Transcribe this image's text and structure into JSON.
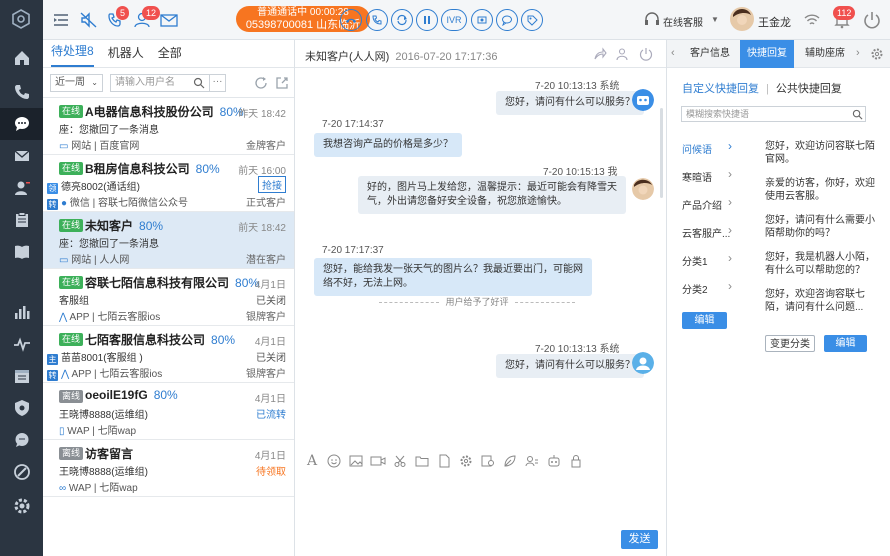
{
  "colors": {
    "accent": "#2f7dd0",
    "online": "#3db05a",
    "offline": "#8a8f94",
    "orange": "#f77520",
    "nav_bg": "#2b3541"
  },
  "topbar": {
    "badges": {
      "missed": "5",
      "queue": "12",
      "notify": "112"
    },
    "call": {
      "line1": "普通通话中 00:00:28",
      "line2": "05398700081 山东临沂"
    },
    "ivr": "IVR",
    "agent_status": "在线客服",
    "agent_name": "王金龙"
  },
  "list": {
    "tabs": [
      "待处理8",
      "机器人",
      "全部"
    ],
    "filter_value": "近一周",
    "search_placeholder": "请输入用户名",
    "more": "···",
    "items": [
      {
        "status": "在线",
        "name": "A电器信息科技股份公司",
        "pct": "80%",
        "time": "昨天 18:42",
        "line2": "座：您撤回了一条消息",
        "line3": "网站 | 百度官网",
        "right2": "",
        "right3": "金牌客户"
      },
      {
        "status": "在线",
        "name": "B租房信息科技公司",
        "pct": "80%",
        "time": "前天 16:00",
        "line2": "德亮8002(通话组)",
        "line3": "微信 | 容联七陌微信公众号",
        "right2": "抢接",
        "right3": "正式客户"
      },
      {
        "status": "在线",
        "name": "未知客户",
        "pct": "80%",
        "time": "前天 18:42",
        "line2": "座：您撤回了一条消息",
        "line3": "网站 | 人人网",
        "right2": "",
        "right3": "潜在客户"
      },
      {
        "status": "在线",
        "name": "容联七陌信息科技有限公司",
        "pct": "80%",
        "time": "4月1日",
        "line2": "客服组",
        "line3": "APP | 七陌云客服ios",
        "right2": "已关闭",
        "right3": "银牌客户"
      },
      {
        "status": "在线",
        "name": "七陌客服信息科技公司",
        "pct": "80%",
        "time": "4月1日",
        "line2": "苗苗8001(客服组 )",
        "line3": "APP | 七陌云客服ios",
        "right2": "已关闭",
        "right3": "银牌客户"
      },
      {
        "status": "离线",
        "name": "oeoilE19fG",
        "pct": "80%",
        "time": "4月1日",
        "line2": "王晓博8888(运维组)",
        "line3": "WAP | 七陌wap",
        "right2": "已流转",
        "right3": ""
      },
      {
        "status": "离线",
        "name": "访客留言",
        "pct": "",
        "time": "4月1日",
        "line2": "王晓博8888(运维组)",
        "line3": "WAP | 七陌wap",
        "right2": "待领取",
        "right3": ""
      }
    ]
  },
  "chat": {
    "title": "未知客户(人人网)",
    "datetime": "2016-07-20 17:17:36",
    "messages": [
      {
        "meta": "7-20  10:13:13  系统",
        "text": "您好，请问有什么可以服务？"
      },
      {
        "meta": "7-20  17:14:37",
        "text": "我想咨询产品的价格是多少？"
      },
      {
        "meta": "7-20  10:15:13  我",
        "text": "好的，图片马上发给您，温馨提示：最近可能会有降雪天气，外出请您备好安全设备，祝您旅途愉快。"
      },
      {
        "meta": "用户给予了好评",
        "text": ""
      },
      {
        "meta": "7-20  17:17:37",
        "text": "您好，能给我发一张天气的图片么？我最近要出门，可能网络不好，无法上网。"
      },
      {
        "meta": "7-20  10:13:13  系统",
        "text": "您好，请问有什么可以服务？"
      }
    ],
    "send": "发送"
  },
  "right": {
    "tabs": [
      "客户信息",
      "快捷回复",
      "辅助座席"
    ],
    "sub_custom": "自定义快捷回复",
    "sub_public": "公共快捷回复",
    "search_placeholder": "模糊搜索快捷语",
    "categories": [
      "问候语",
      "寒暄语",
      "产品介绍",
      "云客服产...",
      "分类1",
      "分类2"
    ],
    "replies": [
      "您好，欢迎访问容联七陌官网。",
      "亲爱的访客，你好，欢迎使用云客服。",
      "您好，请问有什么需要小陌帮助你的吗？",
      "您好，我是机器人小陌，有什么可以帮助您的？",
      "您好，欢迎咨询容联七陌，请问有什么问题..."
    ],
    "edit": "编辑",
    "change": "变更分类"
  }
}
